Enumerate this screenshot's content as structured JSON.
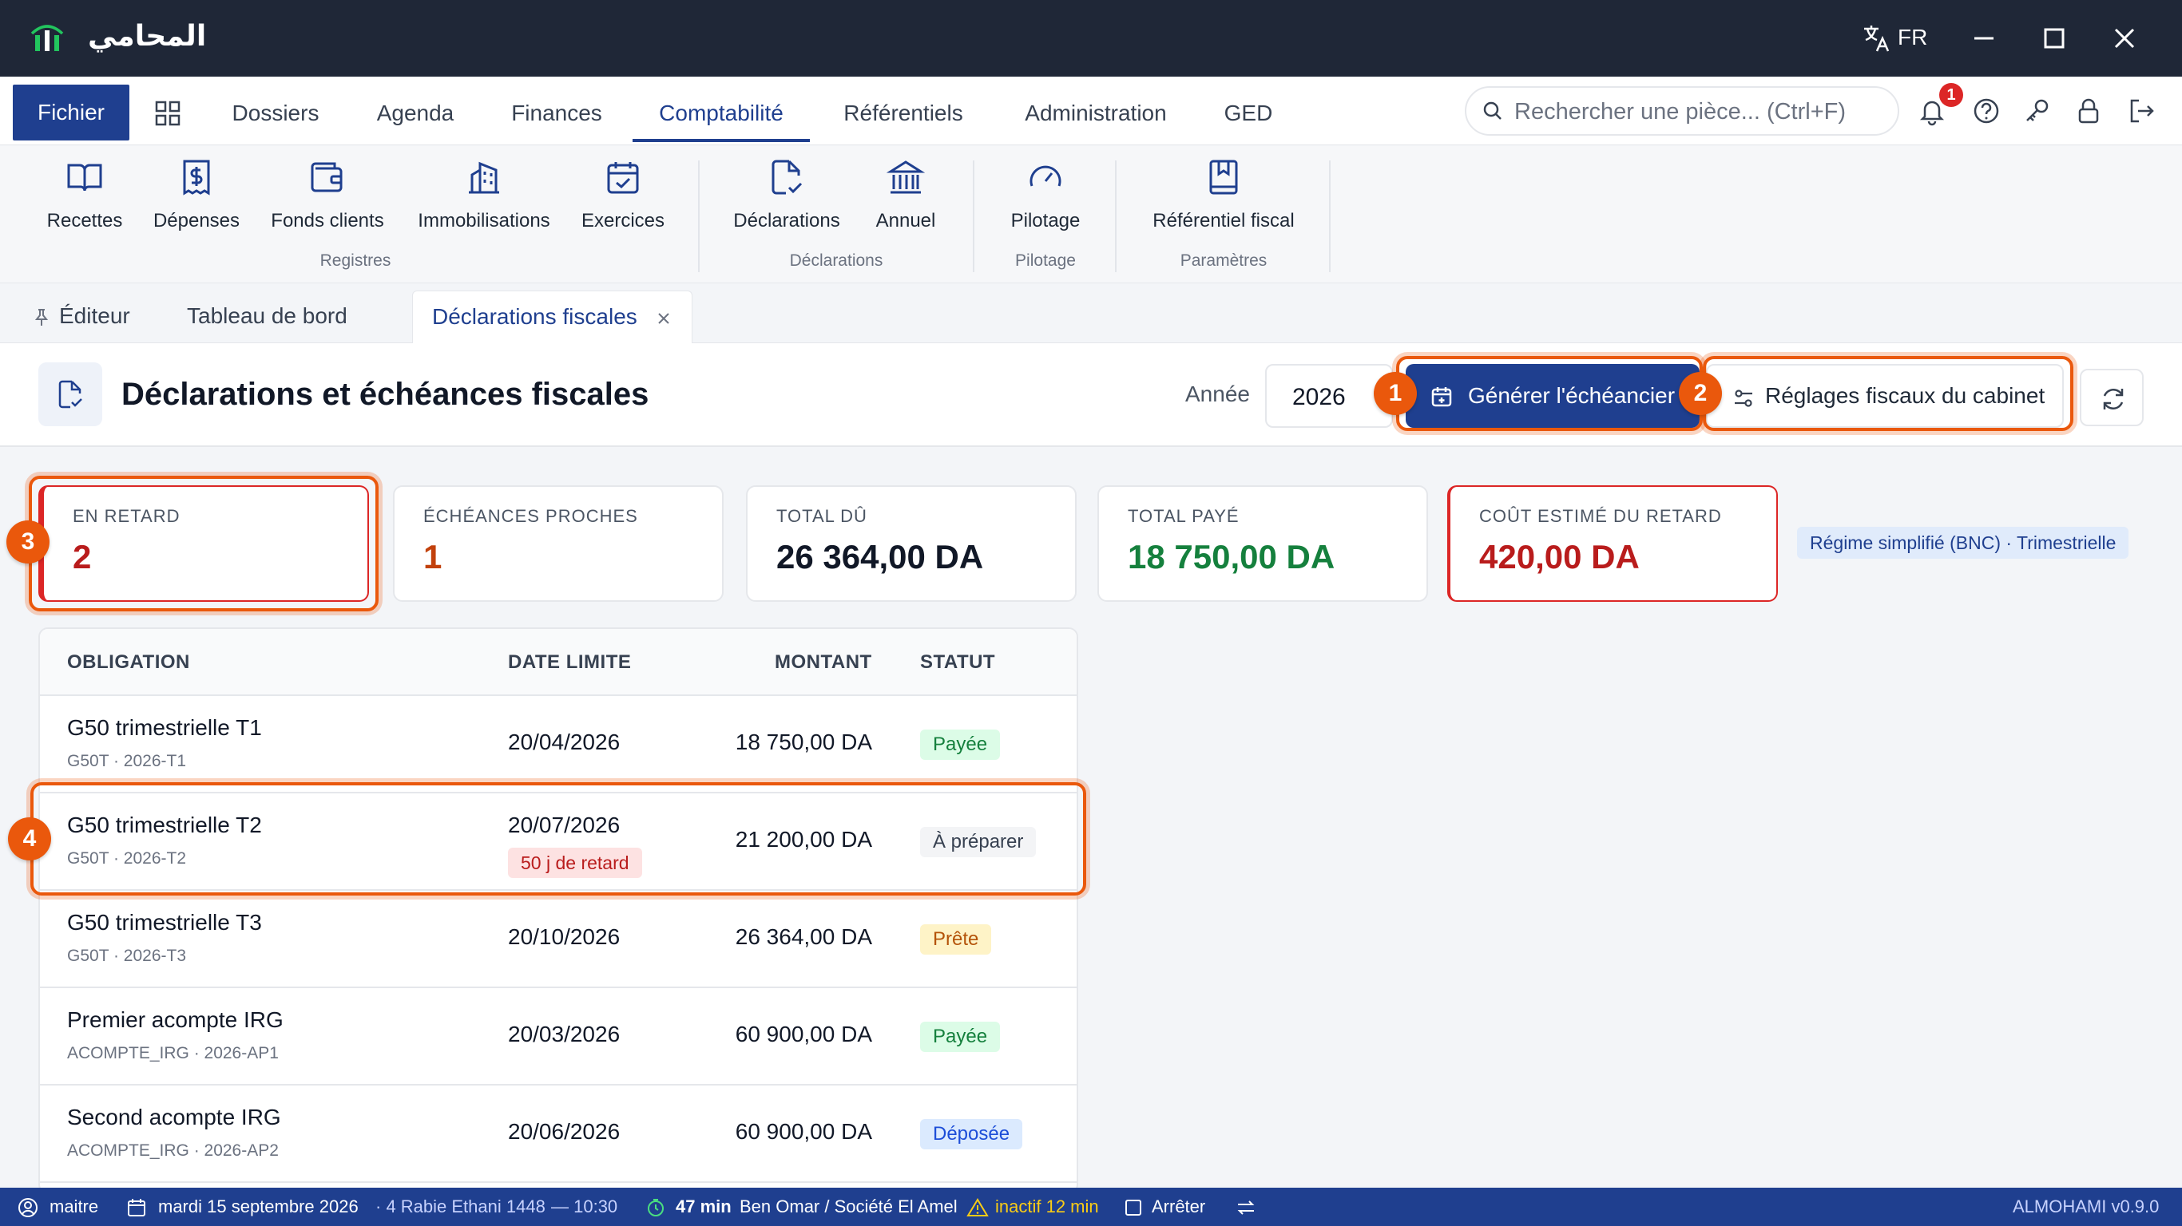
{
  "app": {
    "title": "المحامي",
    "lang": "FR"
  },
  "menu": {
    "fichier": "Fichier",
    "tabs": [
      "Dossiers",
      "Agenda",
      "Finances",
      "Comptabilité",
      "Référentiels",
      "Administration",
      "GED"
    ],
    "active_tab": "Comptabilité",
    "search_placeholder": "Rechercher une pièce... (Ctrl+F)",
    "notifications_count": "1"
  },
  "ribbon": {
    "items": [
      {
        "label": "Recettes",
        "icon": "book-open-icon"
      },
      {
        "label": "Dépenses",
        "icon": "dollar-receipt-icon"
      },
      {
        "label": "Fonds clients",
        "icon": "wallet-icon"
      },
      {
        "label": "Immobilisations",
        "icon": "building-icon"
      },
      {
        "label": "Exercices",
        "icon": "calendar-check-icon"
      },
      {
        "label": "Déclarations",
        "icon": "file-check-icon"
      },
      {
        "label": "Annuel",
        "icon": "bank-icon"
      },
      {
        "label": "Pilotage",
        "icon": "gauge-icon"
      },
      {
        "label": "Référentiel fiscal",
        "icon": "bookmark-book-icon"
      }
    ],
    "groups": [
      "Registres",
      "Déclarations",
      "Pilotage",
      "Paramètres"
    ]
  },
  "doc_tabs": {
    "editor": "Éditeur",
    "dashboard": "Tableau de bord",
    "active": "Déclarations fiscales"
  },
  "page": {
    "title": "Déclarations et échéances fiscales",
    "year_label": "Année",
    "year": "2026",
    "generate_button": "Générer l'échéancier",
    "settings_button": "Réglages fiscaux du cabinet"
  },
  "highlights": [
    "1",
    "2",
    "3",
    "4"
  ],
  "kpis": [
    {
      "label": "EN RETARD",
      "value": "2",
      "color": "#b91c1c"
    },
    {
      "label": "ÉCHÉANCES PROCHES",
      "value": "1",
      "color": "#c2410c"
    },
    {
      "label": "TOTAL DÛ",
      "value": "26 364,00 DA",
      "color": "#111827"
    },
    {
      "label": "TOTAL PAYÉ",
      "value": "18 750,00 DA",
      "color": "#15803d"
    },
    {
      "label": "COÛT ESTIMÉ DU RETARD",
      "value": "420,00 DA",
      "color": "#b91c1c"
    }
  ],
  "regime": "Régime simplifié (BNC) · Trimestrielle",
  "table": {
    "headers": [
      "OBLIGATION",
      "DATE LIMITE",
      "MONTANT",
      "STATUT"
    ],
    "rows": [
      {
        "name": "G50 trimestrielle T1",
        "code": "G50T · 2026-T1",
        "date": "20/04/2026",
        "late": "",
        "amount": "18 750,00 DA",
        "status": "Payée",
        "status_bg": "#dcfce7",
        "status_fg": "#15803d"
      },
      {
        "name": "G50 trimestrielle T2",
        "code": "G50T · 2026-T2",
        "date": "20/07/2026",
        "late": "50 j de retard",
        "amount": "21 200,00 DA",
        "status": "À préparer",
        "status_bg": "#f3f4f6",
        "status_fg": "#374151"
      },
      {
        "name": "G50 trimestrielle T3",
        "code": "G50T · 2026-T3",
        "date": "20/10/2026",
        "late": "",
        "amount": "26 364,00 DA",
        "status": "Prête",
        "status_bg": "#fef3c7",
        "status_fg": "#b45309"
      },
      {
        "name": "Premier acompte IRG",
        "code": "ACOMPTE_IRG · 2026-AP1",
        "date": "20/03/2026",
        "late": "",
        "amount": "60 900,00 DA",
        "status": "Payée",
        "status_bg": "#dcfce7",
        "status_fg": "#15803d"
      },
      {
        "name": "Second acompte IRG",
        "code": "ACOMPTE_IRG · 2026-AP2",
        "date": "20/06/2026",
        "late": "",
        "amount": "60 900,00 DA",
        "status": "Déposée",
        "status_bg": "#dbeafe",
        "status_fg": "#1d4ed8"
      }
    ]
  },
  "statusbar": {
    "user": "maitre",
    "date": "mardi 15 septembre 2026",
    "hijri": "· 4 Rabie Ethani 1448",
    "time": "— 10:30",
    "timer": "47 min",
    "client": "Ben Omar / Société El Amel",
    "inactive": "inactif 12 min",
    "stop": "Arrêter",
    "version": "ALMOHAMI v0.9.0"
  }
}
